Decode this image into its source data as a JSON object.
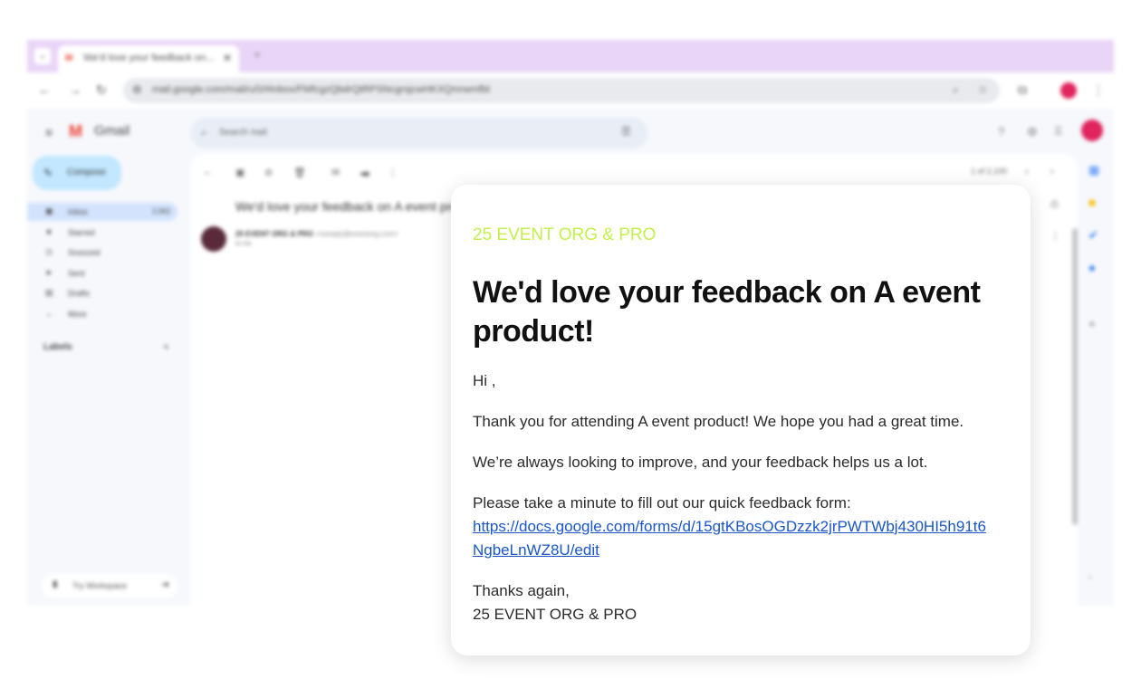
{
  "browser": {
    "tab_title": "We'd love your feedback on...",
    "tab_favicon": "gmail-icon",
    "url": "mail.google.com/mail/u/0/#inbox/FMfcgzQbdrQtRPSNcgrsjcwHKXQmrwmfbt",
    "profile_color": "#e0245e"
  },
  "gmail": {
    "brand": "Gmail",
    "compose_label": "Compose",
    "search_placeholder": "Search mail",
    "nav": [
      {
        "label": "Inbox",
        "count": "2,062",
        "icon": "inbox-icon",
        "active": true
      },
      {
        "label": "Starred",
        "count": "",
        "icon": "star-icon",
        "active": false
      },
      {
        "label": "Snoozed",
        "count": "",
        "icon": "clock-icon",
        "active": false
      },
      {
        "label": "Sent",
        "count": "",
        "icon": "send-icon",
        "active": false
      },
      {
        "label": "Drafts",
        "count": "",
        "icon": "draft-icon",
        "active": false
      },
      {
        "label": "More",
        "count": "",
        "icon": "chevron-down-icon",
        "active": false
      }
    ],
    "labels_heading": "Labels",
    "workspace_label": "Try Workspace",
    "pager": "1 of 2,100",
    "subject": "We'd love your feedback on A event product!",
    "sender_name": "25 EVENT ORG & PRO",
    "sender_address": "<noreply@eventorg.com>",
    "sender_to": "to me"
  },
  "email": {
    "org": "25 EVENT ORG & PRO",
    "title": "We'd love your feedback on A event product!",
    "greeting": "Hi ,",
    "thanks": "Thank you for attending A event product! We hope you had a great time.",
    "improve": "We’re always looking to improve, and your feedback helps us a lot.",
    "please": "Please take a minute to fill out our quick feedback form:",
    "link": "https://docs.google.com/forms/d/15gtKBosOGDzzk2jrPWTWbj430HI5h91t6NgbeLnWZ8U/edit",
    "signoff": "Thanks again,",
    "signature": "25 EVENT ORG & PRO",
    "org_color": "#c3f04e",
    "link_color": "#1a56c9"
  }
}
